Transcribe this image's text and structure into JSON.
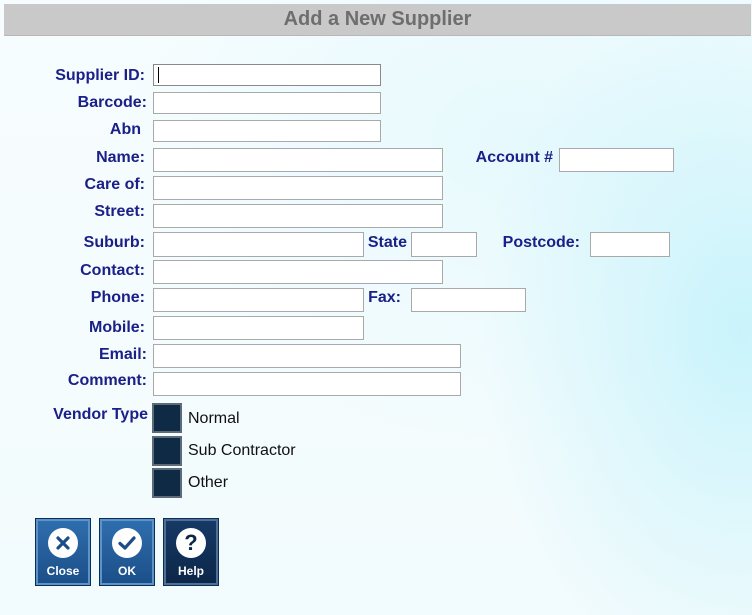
{
  "window": {
    "title": "Add a New Supplier"
  },
  "form": {
    "supplier_id": {
      "label": "Supplier ID:",
      "value": ""
    },
    "barcode": {
      "label": "Barcode:",
      "value": ""
    },
    "abn": {
      "label": "Abn",
      "value": ""
    },
    "name": {
      "label": "Name:",
      "value": ""
    },
    "account": {
      "label": "Account #",
      "value": ""
    },
    "care_of": {
      "label": "Care of:",
      "value": ""
    },
    "street": {
      "label": "Street:",
      "value": ""
    },
    "suburb": {
      "label": "Suburb:",
      "value": ""
    },
    "state": {
      "label": "State",
      "value": ""
    },
    "postcode": {
      "label": "Postcode:",
      "value": ""
    },
    "contact": {
      "label": "Contact:",
      "value": ""
    },
    "phone": {
      "label": "Phone:",
      "value": ""
    },
    "fax": {
      "label": "Fax:",
      "value": ""
    },
    "mobile": {
      "label": "Mobile:",
      "value": ""
    },
    "email": {
      "label": "Email:",
      "value": ""
    },
    "comment": {
      "label": "Comment:",
      "value": ""
    }
  },
  "vendor_type": {
    "label": "Vendor Type",
    "options": [
      {
        "label": "Normal",
        "checked": false
      },
      {
        "label": "Sub Contractor",
        "checked": false
      },
      {
        "label": "Other",
        "checked": false
      }
    ]
  },
  "buttons": {
    "close": {
      "label": "Close",
      "icon": "close-icon"
    },
    "ok": {
      "label": "OK",
      "icon": "check-icon"
    },
    "help": {
      "label": "Help",
      "icon": "help-icon"
    }
  },
  "colors": {
    "label_text": "#1a2088",
    "title_bar": "#c9c9c9",
    "checkbox_fill": "#0e2a44",
    "button_blue": "#1b4e88",
    "button_dark": "#0c2648"
  }
}
